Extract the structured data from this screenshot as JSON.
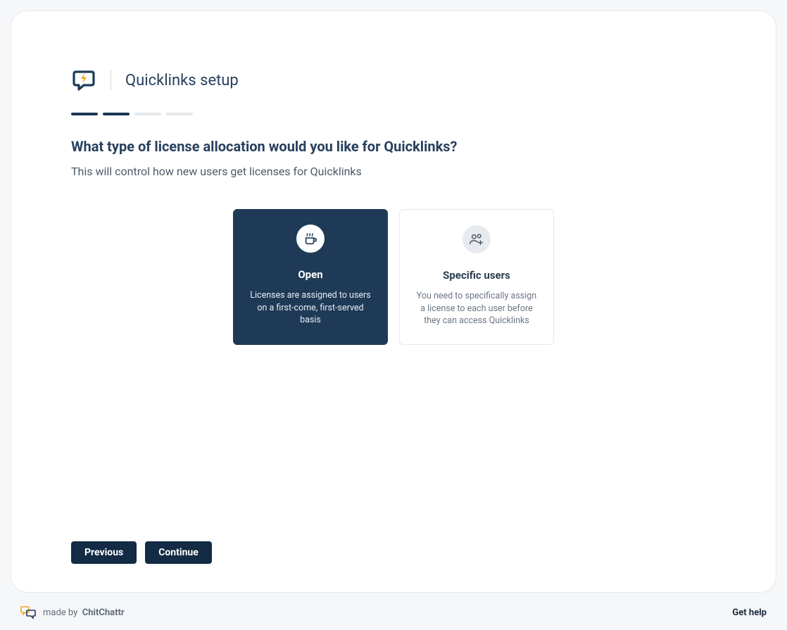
{
  "header": {
    "title": "Quicklinks setup"
  },
  "progress": {
    "total": 4,
    "completed": 2
  },
  "question": {
    "title": "What type of license allocation would you like for Quicklinks?",
    "subtitle": "This will control how new users get licenses for Quicklinks"
  },
  "options": [
    {
      "title": "Open",
      "description": "Licenses are assigned to users on a first-come, first-served basis",
      "selected": true,
      "icon": "coffee-icon"
    },
    {
      "title": "Specific users",
      "description": "You need to specifically assign a license to each user before they can access Quicklinks",
      "selected": false,
      "icon": "users-add-icon"
    }
  ],
  "buttons": {
    "previous": "Previous",
    "continue": "Continue"
  },
  "footer": {
    "made_by": "made by",
    "brand": "ChitChattr",
    "help": "Get help"
  }
}
